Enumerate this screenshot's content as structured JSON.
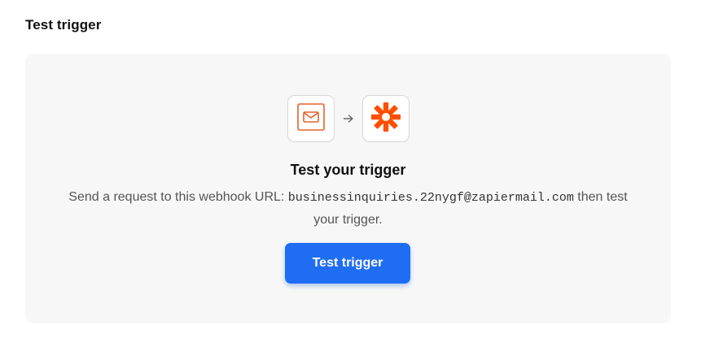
{
  "section": {
    "title": "Test trigger"
  },
  "panel": {
    "source_app_icon": "email-icon",
    "arrow_icon": "arrow-right-icon",
    "target_app_icon": "zapier-logo-icon",
    "heading": "Test your trigger",
    "description_prefix": "Send a request to this webhook URL: ",
    "webhook_email": "businessinquiries.22nygf@zapiermail.com",
    "description_line1_suffix": " then test",
    "description_line2": "your trigger.",
    "button_label": "Test trigger"
  },
  "colors": {
    "accent_blue": "#1f6df2",
    "zapier_orange": "#ff4f00",
    "email_orange": "#e5622b",
    "panel_bg": "#f7f7f7"
  }
}
